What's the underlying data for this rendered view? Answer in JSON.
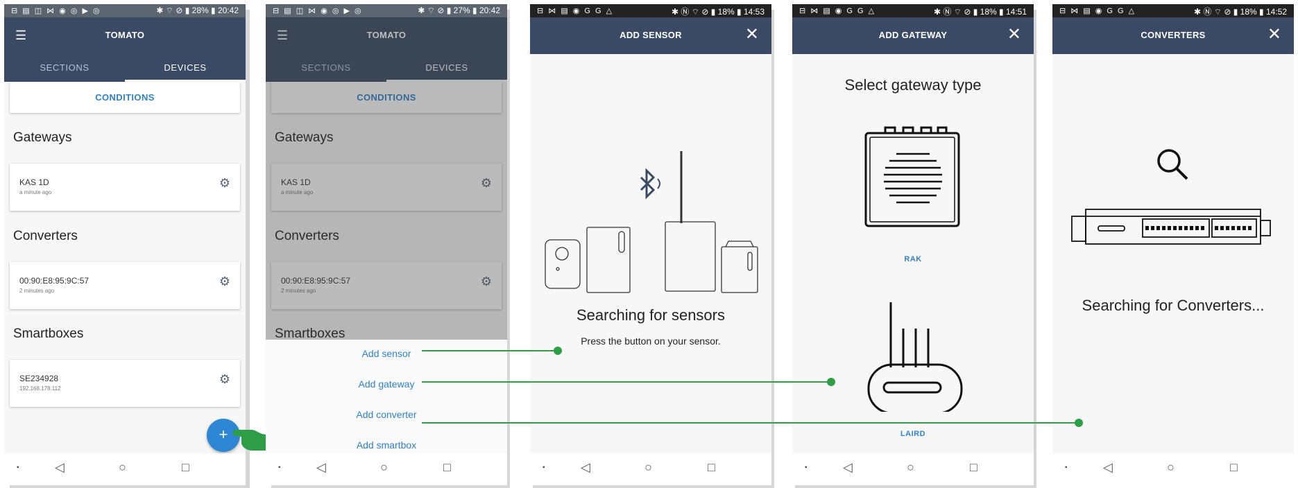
{
  "screens": {
    "s1": {
      "status_left": "⊟ ▤ ◫ ⋈ ◉ ◎ ▶ ◎",
      "status_right": "✱ ⌔ ⊘ ▮ 28% ▮ 20:42",
      "title": "TOMATO",
      "tabs": [
        "SECTIONS",
        "DEVICES"
      ],
      "conditions": "CONDITIONS",
      "gateways_title": "Gateways",
      "gateway": {
        "name": "KAS 1D",
        "sub": "a minute ago"
      },
      "converters_title": "Converters",
      "converter": {
        "name": "00:90:E8:95:9C:57",
        "sub": "2 minutes ago"
      },
      "smartboxes_title": "Smartboxes",
      "smartbox": {
        "name": "SE234928",
        "sub": "192.168.178.112"
      },
      "fab": "+"
    },
    "s2": {
      "status_left": "⊟ ▤ ◫ ⋈ ◉ ◎ ▶ ◎",
      "status_right": "✱ ⌔ ⊘ ▮ 27% ▮ 20:42",
      "title": "TOMATO",
      "tabs": [
        "SECTIONS",
        "DEVICES"
      ],
      "conditions": "CONDITIONS",
      "gateways_title": "Gateways",
      "gateway": {
        "name": "KAS 1D",
        "sub": "a minute ago"
      },
      "converters_title": "Converters",
      "converter": {
        "name": "00:90:E8:95:9C:57",
        "sub": "2 minutes ago"
      },
      "smartboxes_title": "Smartboxes",
      "menu": [
        "Add sensor",
        "Add gateway",
        "Add converter",
        "Add smartbox"
      ]
    },
    "s3": {
      "status_left": "⊟ ⋈ ▤ ◉ G G △",
      "status_right": "✱ Ⓝ ⌔ ⊘ ▮ 18% ▮ 14:53",
      "title": "ADD SENSOR",
      "heading": "Searching for sensors",
      "sub": "Press the button on your sensor."
    },
    "s4": {
      "status_left": "⊟ ⋈ ▤ ◉ G G △",
      "status_right": "✱ Ⓝ ⌔ ⊘ ▮ 18% ▮ 14:51",
      "title": "ADD GATEWAY",
      "heading": "Select gateway type",
      "option1": "RAK",
      "option2": "LAIRD"
    },
    "s5": {
      "status_left": "⊟ ⋈ ▤ ◉ G G △",
      "status_right": "✱ Ⓝ ⌔ ⊘ ▮ 18% ▮ 14:52",
      "title": "CONVERTERS",
      "heading": "Searching for Converters..."
    }
  },
  "colors": {
    "appbar": "#3a4a65",
    "accent": "#2f82c6",
    "fab": "#2d86d3",
    "pointer": "#2e9e46"
  },
  "icons": {
    "menu": "☰",
    "close": "✕",
    "gear": "⚙",
    "nav_square_small": "▪",
    "nav_back": "◁",
    "nav_home": "○",
    "nav_recent": "□"
  }
}
